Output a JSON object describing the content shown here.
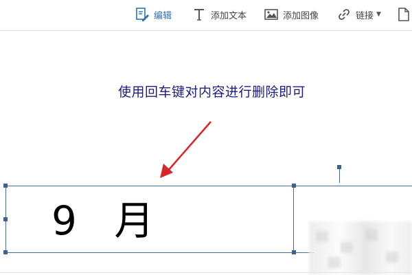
{
  "toolbar": {
    "edit_label": "编辑",
    "add_text_label": "添加文本",
    "add_image_label": "添加图像",
    "link_label": "链接",
    "icons": {
      "edit": "edit-document-icon",
      "add_text": "text-t-icon",
      "add_image": "image-icon",
      "link": "chain-link-icon",
      "more": "document-icon"
    },
    "active_color": "#2e6fb7"
  },
  "annotation": {
    "text": "使用回车键对内容进行删除即可",
    "color": "#1d1a86",
    "arrow_color": "#d9262b"
  },
  "textbox": {
    "content": "9 月",
    "border_color": "#4a6a9c"
  }
}
